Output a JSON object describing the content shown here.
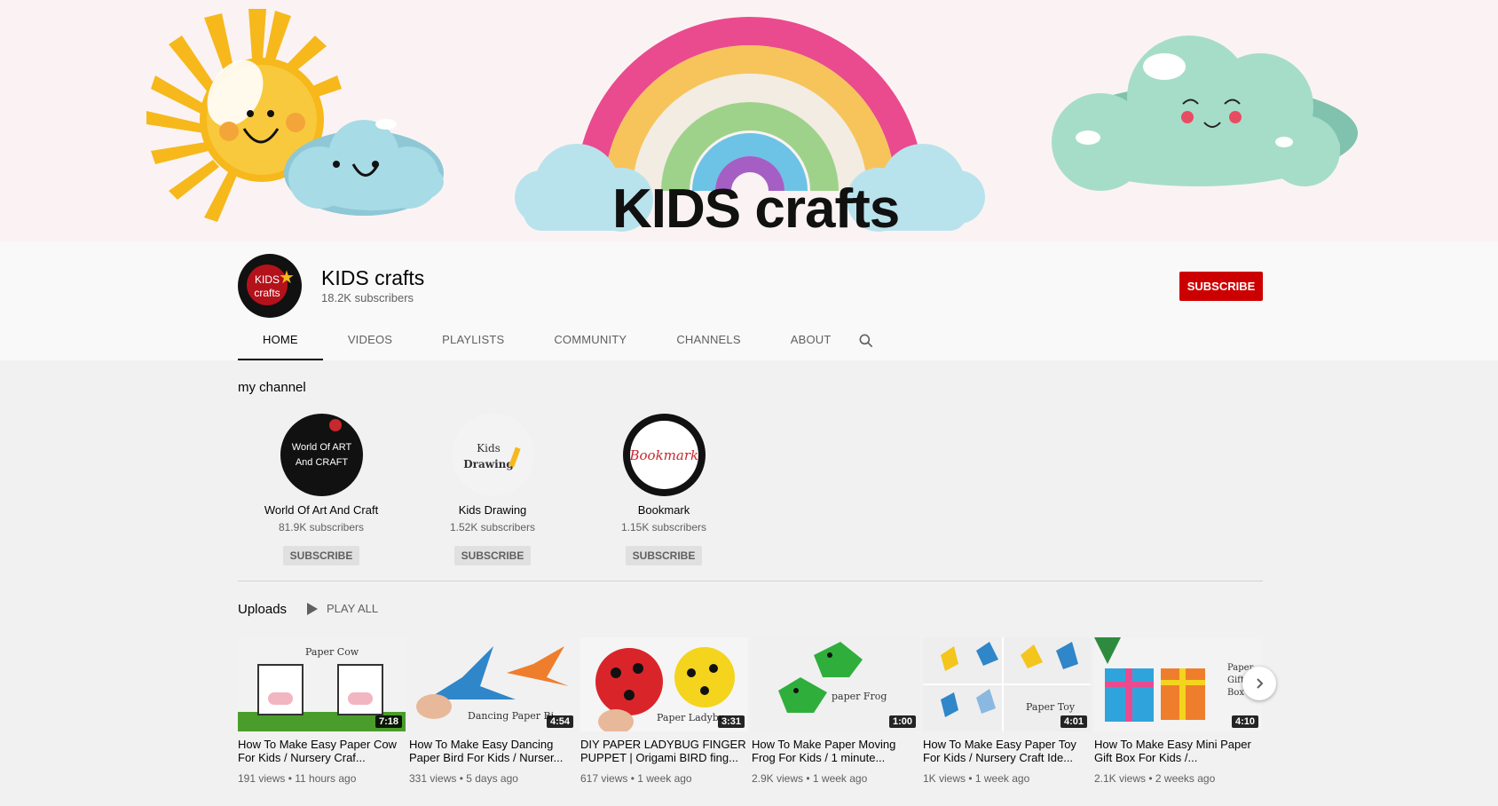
{
  "banner": {
    "title": "KIDS crafts"
  },
  "channel": {
    "avatar_text_1": "KIDS",
    "avatar_text_2": "crafts",
    "name": "KIDS crafts",
    "subscribers": "18.2K subscribers",
    "subscribe_label": "SUBSCRIBE"
  },
  "tabs": [
    {
      "label": "HOME"
    },
    {
      "label": "VIDEOS"
    },
    {
      "label": "PLAYLISTS"
    },
    {
      "label": "COMMUNITY"
    },
    {
      "label": "CHANNELS"
    },
    {
      "label": "ABOUT"
    }
  ],
  "my_channel": {
    "title": "my channel",
    "channels": [
      {
        "name": "World Of Art And Craft",
        "subscribers": "81.9K subscribers",
        "subscribe_label": "SUBSCRIBE",
        "logo_line1": "World Of ART",
        "logo_line2": "And CRAFT"
      },
      {
        "name": "Kids Drawing",
        "subscribers": "1.52K subscribers",
        "subscribe_label": "SUBSCRIBE",
        "logo_line1": "Kids",
        "logo_line2": "Drawing"
      },
      {
        "name": "Bookmark",
        "subscribers": "1.15K subscribers",
        "subscribe_label": "SUBSCRIBE",
        "logo_line1": "Bookmark"
      }
    ]
  },
  "uploads": {
    "title": "Uploads",
    "play_all": "PLAY ALL",
    "videos": [
      {
        "title": "How To Make Easy Paper Cow For Kids / Nursery Craf...",
        "meta": "191 views • 11 hours ago",
        "duration": "7:18",
        "thumb_text": "Paper Cow"
      },
      {
        "title": "How To Make Easy Dancing Paper Bird For Kids / Nurser...",
        "meta": "331 views • 5 days ago",
        "duration": "4:54",
        "thumb_text": "Dancing Paper Bi"
      },
      {
        "title": "DIY PAPER LADYBUG FINGER PUPPET | Origami BIRD fing...",
        "meta": "617 views • 1 week ago",
        "duration": "3:31",
        "thumb_text": "Paper Ladybu"
      },
      {
        "title": "How To Make Paper Moving Frog For Kids / 1 minute...",
        "meta": "2.9K views • 1 week ago",
        "duration": "1:00",
        "thumb_text": "paper Frog"
      },
      {
        "title": "How To Make Easy Paper Toy For Kids / Nursery Craft Ide...",
        "meta": "1K views • 1 week ago",
        "duration": "4:01",
        "thumb_text": "Paper Toy"
      },
      {
        "title": "How To Make Easy Mini Paper Gift Box For Kids /...",
        "meta": "2.1K views • 2 weeks ago",
        "duration": "4:10",
        "thumb_text": "Paper Gift Box"
      }
    ]
  },
  "colors": {
    "subscribe_red": "#cc0000",
    "background": "#f1f1f1",
    "header_bg": "#f9f9f9"
  }
}
